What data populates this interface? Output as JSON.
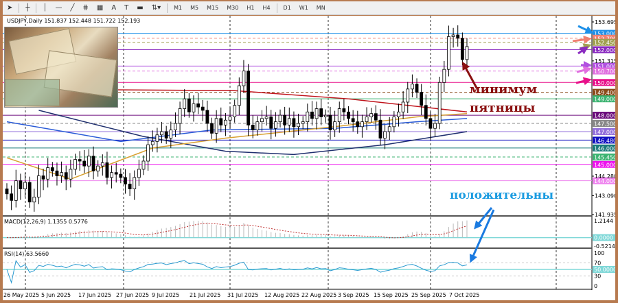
{
  "toolbar": {
    "tools": [
      "cursor",
      "crosshair",
      "vertical-line",
      "horizontal-line",
      "trendline",
      "fibonacci",
      "grid",
      "text",
      "text-label",
      "rectangle",
      "arrows"
    ],
    "text_tool": "A",
    "timeframes": [
      "M1",
      "M5",
      "M15",
      "M30",
      "H1",
      "H4",
      "D1",
      "W1",
      "MN"
    ]
  },
  "chart_title": "USDJPY,Daily  151.837 152.448 151.722 152.193",
  "annotations": {
    "line1": "минимум",
    "line2": "пятницы",
    "positive": "положительны"
  },
  "chart_data": {
    "type": "candlestick",
    "symbol": "USDJPY",
    "timeframe": "Daily",
    "ohlc_last": {
      "open": 151.837,
      "high": 152.448,
      "low": 151.722,
      "close": 152.193
    },
    "closes": [
      143.2,
      142.8,
      144.0,
      143.5,
      143.9,
      142.7,
      143.0,
      144.3,
      144.1,
      144.8,
      144.6,
      144.3,
      144.5,
      144.1,
      144.7,
      145.3,
      145.2,
      144.9,
      145.5,
      144.6,
      144.9,
      145.1,
      144.2,
      144.5,
      144.4,
      144.2,
      143.8,
      143.5,
      144.2,
      144.7,
      145.2,
      146.2,
      146.4,
      146.8,
      147.0,
      146.6,
      147.1,
      147.5,
      148.4,
      149.0,
      148.2,
      148.7,
      148.5,
      148.3,
      147.5,
      146.9,
      147.8,
      147.4,
      147.7,
      147.9,
      148.6,
      149.8,
      150.7,
      147.4,
      147.1,
      147.6,
      147.8,
      147.9,
      147.2,
      147.6,
      148.0,
      147.4,
      147.8,
      147.3,
      147.5,
      147.6,
      148.2,
      147.8,
      148.4,
      147.9,
      148.0,
      147.1,
      147.6,
      148.4,
      148.2,
      147.8,
      147.6,
      147.3,
      147.6,
      147.9,
      148.1,
      147.7,
      146.6,
      147.0,
      147.3,
      147.9,
      148.2,
      148.8,
      149.6,
      149.9,
      149.4,
      148.6,
      147.8,
      147.2,
      147.5,
      150.0,
      150.8,
      152.8,
      152.9,
      152.7,
      151.4,
      152.193
    ],
    "moving_averages": [
      {
        "color": "#c0141c",
        "points": [
          [
            0,
            149.6
          ],
          [
            50,
            149.5
          ],
          [
            75,
            149.0
          ],
          [
            101,
            148.2
          ]
        ]
      },
      {
        "color": "#2a5bd7",
        "points": [
          [
            0,
            147.6
          ],
          [
            25,
            146.4
          ],
          [
            45,
            147.1
          ],
          [
            72,
            147.2
          ],
          [
            90,
            147.6
          ],
          [
            101,
            147.8
          ]
        ]
      },
      {
        "color": "#1f2f6e",
        "points": [
          [
            7,
            148.3
          ],
          [
            30,
            146.7
          ],
          [
            48,
            145.8
          ],
          [
            63,
            145.6
          ],
          [
            83,
            146.2
          ],
          [
            101,
            147.0
          ]
        ]
      },
      {
        "color": "#d8a030",
        "points": [
          [
            0,
            145.4
          ],
          [
            14,
            144.1
          ],
          [
            32,
            146.0
          ],
          [
            48,
            146.6
          ],
          [
            72,
            147.3
          ],
          [
            90,
            147.9
          ],
          [
            101,
            148.1
          ]
        ]
      }
    ],
    "levels": [
      {
        "price": "153.000",
        "color": "#1e90e8",
        "dash": false
      },
      {
        "price": "152.700",
        "color": "#f08070",
        "dash": true
      },
      {
        "price": "152.450",
        "color": "#a0a050",
        "dash": true
      },
      {
        "price": "152.000",
        "color": "#8a2bc0",
        "dash": false
      },
      {
        "price": "151.000",
        "color": "#b050e0",
        "dash": false
      },
      {
        "price": "150.700",
        "color": "#e070e0",
        "dash": true
      },
      {
        "price": "150.000",
        "color": "#e8108a",
        "dash": false
      },
      {
        "price": "149.400",
        "color": "#8b4a1a",
        "dash": true
      },
      {
        "price": "149.000",
        "color": "#3cb371",
        "dash": false
      },
      {
        "price": "148.000",
        "color": "#6a0a7a",
        "dash": false
      },
      {
        "price": "147.500",
        "color": "#888888",
        "dash": true
      },
      {
        "price": "147.000",
        "color": "#9370db",
        "dash": false
      },
      {
        "price": "146.480",
        "color": "#1010c0",
        "dash": false
      },
      {
        "price": "146.000",
        "color": "#1a7a7a",
        "dash": false
      },
      {
        "price": "145.450",
        "color": "#3cb371",
        "dash": true
      },
      {
        "price": "145.000",
        "color": "#ee10ee",
        "dash": false
      },
      {
        "price": "144.000",
        "color": "#ee82ee",
        "dash": false
      }
    ],
    "price_ticks": [
      "153.695",
      "151.315",
      "144.280",
      "143.090",
      "141.935"
    ],
    "ylim": [
      141.935,
      153.695
    ],
    "date_ticks": [
      "26 May 2025",
      "5 Jun 2025",
      "17 Jun 2025",
      "27 Jun 2025",
      "9 Jul 2025",
      "21 Jul 2025",
      "31 Jul 2025",
      "12 Aug 2025",
      "22 Aug 2025",
      "3 Sep 2025",
      "15 Sep 2025",
      "25 Sep 2025",
      "7 Oct 2025"
    ],
    "macd": {
      "title": "MACD(12,26,9) 1.1355 0.5776",
      "ticks": [
        "1.2144",
        "0.0000",
        "-0.5214"
      ],
      "range": [
        -0.5214,
        1.2144
      ]
    },
    "rsi": {
      "title": "RSI(14) 63.5660",
      "ticks": [
        "100",
        "70",
        "50.0000",
        "30",
        "0"
      ]
    }
  }
}
